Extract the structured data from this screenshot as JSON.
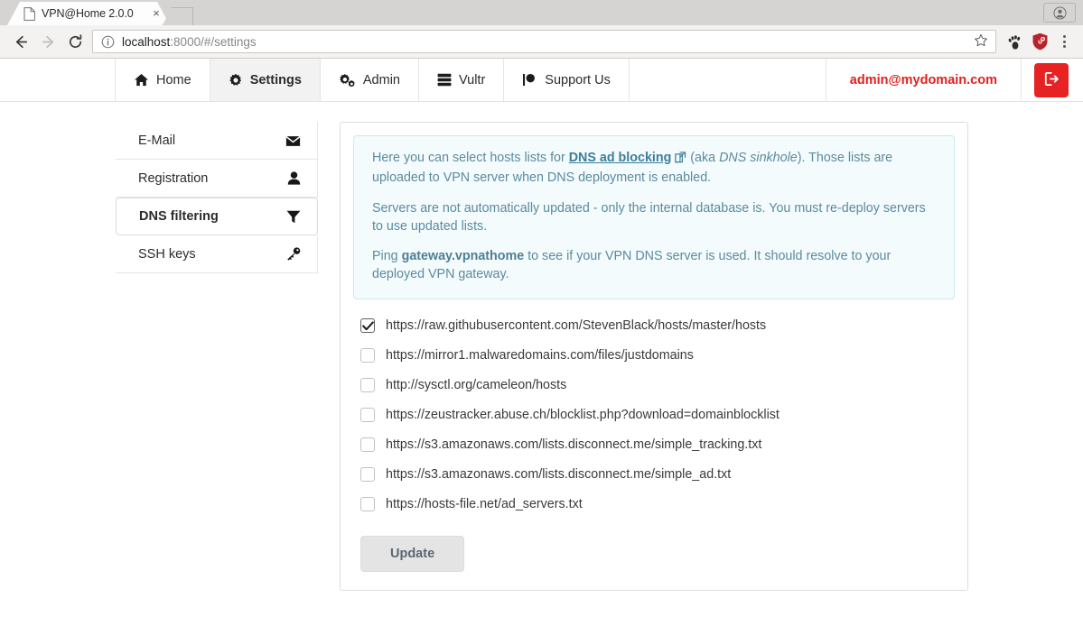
{
  "browser": {
    "tab": {
      "title": "VPN@Home 2.0.0",
      "favicon": "page-icon",
      "close": "×"
    },
    "newtab_label": "+",
    "back_icon": "back-arrow-icon",
    "forward_icon": "forward-arrow-icon",
    "reload_icon": "reload-icon",
    "omnibox": {
      "info_icon": "info-circle-icon",
      "host": "localhost",
      "rest": ":8000/#/settings",
      "full_url": "localhost:8000/#/settings",
      "star_icon": "bookmark-star-icon"
    },
    "extensions": [
      {
        "name": "gnome-extension-icon",
        "color": "#2b2b2b"
      },
      {
        "name": "ublock-origin-icon",
        "color": "#b8232b"
      }
    ],
    "menu_icon": "three-dot-menu-icon",
    "profile_icon": "profile-avatar-icon"
  },
  "topnav": {
    "items": [
      {
        "label": "Home",
        "icon": "home-icon",
        "active": false
      },
      {
        "label": "Settings",
        "icon": "gear-icon",
        "active": true
      },
      {
        "label": "Admin",
        "icon": "cogs-icon",
        "active": false
      },
      {
        "label": "Vultr",
        "icon": "server-icon",
        "active": false
      },
      {
        "label": "Support Us",
        "icon": "support-pin-icon",
        "active": false
      }
    ],
    "user_email": "admin@mydomain.com",
    "user_email_color": "#e02020",
    "logout_icon": "sign-out-icon",
    "logout_color": "#e62222"
  },
  "sidebar": {
    "items": [
      {
        "label": "E-Mail",
        "icon": "envelope-icon",
        "active": false
      },
      {
        "label": "Registration",
        "icon": "user-icon",
        "active": false
      },
      {
        "label": "DNS filtering",
        "icon": "filter-funnel-icon",
        "active": true
      },
      {
        "label": "SSH keys",
        "icon": "key-icon",
        "active": false
      }
    ]
  },
  "alert": {
    "p1_before": "Here you can select hosts lists for ",
    "link_text": "DNS ad blocking",
    "link_icon": "external-link-icon",
    "p1_mid": " (aka ",
    "p1_italic": "DNS sinkhole",
    "p1_after": "). Those lists are uploaded to VPN server when DNS deployment is enabled.",
    "p2": "Servers are not automatically updated - only the internal database is. You must re-deploy servers to use updated lists.",
    "p3_before": "Ping ",
    "p3_bold": "gateway.vpnathome",
    "p3_after": " to see if your VPN DNS server is used. It should resolve to your deployed VPN gateway.",
    "bg_color": "#f4fbfc",
    "text_color": "#5a8b9e"
  },
  "hosts": [
    {
      "url": "https://raw.githubusercontent.com/StevenBlack/hosts/master/hosts",
      "checked": true
    },
    {
      "url": "https://mirror1.malwaredomains.com/files/justdomains",
      "checked": false
    },
    {
      "url": "http://sysctl.org/cameleon/hosts",
      "checked": false
    },
    {
      "url": "https://zeustracker.abuse.ch/blocklist.php?download=domainblocklist",
      "checked": false
    },
    {
      "url": "https://s3.amazonaws.com/lists.disconnect.me/simple_tracking.txt",
      "checked": false
    },
    {
      "url": "https://s3.amazonaws.com/lists.disconnect.me/simple_ad.txt",
      "checked": false
    },
    {
      "url": "https://hosts-file.net/ad_servers.txt",
      "checked": false
    }
  ],
  "update_button": {
    "label": "Update"
  }
}
